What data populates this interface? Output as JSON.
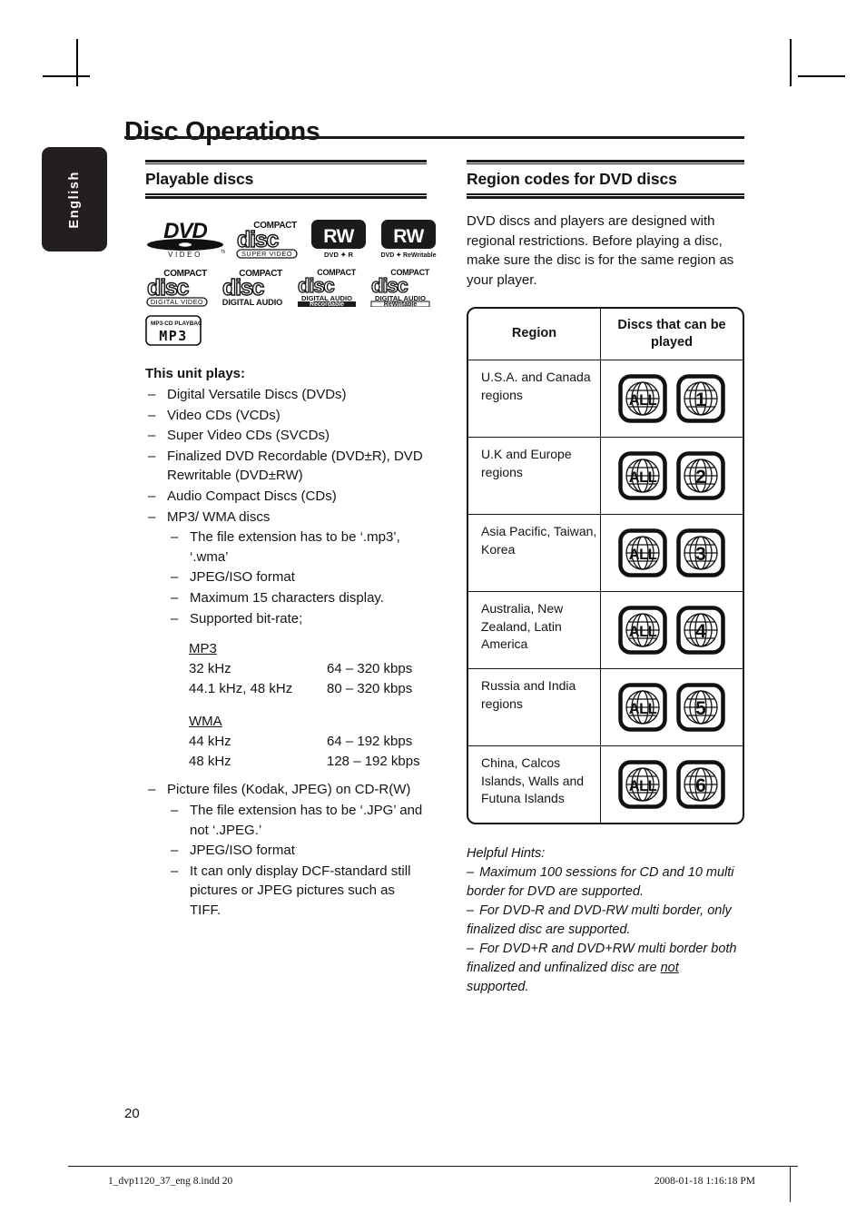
{
  "document": {
    "title": "Disc Operations",
    "language_tab": "English",
    "page_number": "20"
  },
  "footer": {
    "file": "1_dvp1120_37_eng 8.indd   20",
    "timestamp": "2008-01-18   1:16:18 PM"
  },
  "left_column": {
    "heading": "Playable discs",
    "logos": [
      {
        "name": "dvd-video-logo",
        "top": "DVD",
        "bottom": "V I D E O ™"
      },
      {
        "name": "compact-disc-super-video-logo",
        "top": "COMPACT",
        "mid": "disc",
        "bottom": "SUPER  VIDEO"
      },
      {
        "name": "dvd-plus-r-logo",
        "mark": "RW",
        "caption": "DVD ✦ R"
      },
      {
        "name": "dvd-plus-rewritable-logo",
        "mark": "RW",
        "caption": "DVD ✦ ReWritable"
      },
      {
        "name": "compact-disc-digital-video-logo",
        "top": "COMPACT",
        "mid": "disc",
        "bottom": "DIGITAL VIDEO"
      },
      {
        "name": "compact-disc-digital-audio-logo",
        "top": "COMPACT",
        "mid": "disc",
        "bottom": "DIGITAL AUDIO"
      },
      {
        "name": "compact-disc-recordable-logo",
        "top": "COMPACT",
        "mid": "disc",
        "bottom": "DIGITAL AUDIO",
        "bottom2": "Recordable"
      },
      {
        "name": "compact-disc-rewritable-logo",
        "top": "COMPACT",
        "mid": "disc",
        "bottom": "DIGITAL AUDIO",
        "bottom2": "ReWritable"
      },
      {
        "name": "mp3-cd-playback-logo",
        "top": "MP3-CD PLAYBACK",
        "mid": "MP3"
      }
    ],
    "plays_title": "This unit plays:",
    "plays_items": [
      "Digital Versatile Discs (DVDs)",
      "Video CDs (VCDs)",
      "Super Video CDs (SVCDs)",
      "Finalized DVD Recordable (DVD±R), DVD Rewritable (DVD±RW)",
      "Audio Compact Discs (CDs)",
      "MP3/ WMA discs"
    ],
    "mp3_sub_items": [
      "The file extension has to be ‘.mp3’, ‘.wma’",
      "JPEG/ISO format",
      "Maximum 15 characters display.",
      "Supported bit-rate;"
    ],
    "bitrate": {
      "mp3_label": "MP3",
      "mp3_rows": [
        {
          "freq": "32 kHz",
          "rate": "64 – 320 kbps"
        },
        {
          "freq": "44.1 kHz, 48 kHz",
          "rate": "80 – 320 kbps"
        }
      ],
      "wma_label": "WMA",
      "wma_rows": [
        {
          "freq": "44 kHz",
          "rate": "64 – 192 kbps"
        },
        {
          "freq": "48 kHz",
          "rate": "128 – 192 kbps"
        }
      ]
    },
    "picture_item": "Picture files (Kodak, JPEG) on CD-R(W)",
    "picture_sub_items": [
      "The file extension has to be ‘.JPG’ and not ‘.JPEG.’",
      "JPEG/ISO format",
      "It can only display DCF-standard still pictures or JPEG pictures such as TIFF."
    ]
  },
  "right_column": {
    "heading": "Region codes for DVD discs",
    "intro": "DVD discs and players are designed with regional restrictions. Before playing a disc, make sure the disc is for the same region as your player.",
    "table": {
      "headers": [
        "Region",
        "Discs that can be played"
      ],
      "rows": [
        {
          "region": "U.S.A. and Canada regions",
          "codes": [
            "ALL",
            "1"
          ]
        },
        {
          "region": "U.K and Europe regions",
          "codes": [
            "ALL",
            "2"
          ]
        },
        {
          "region": "Asia Pacific, Taiwan, Korea",
          "codes": [
            "ALL",
            "3"
          ]
        },
        {
          "region": "Australia, New Zealand, Latin America",
          "codes": [
            "ALL",
            "4"
          ]
        },
        {
          "region": "Russia and India regions",
          "codes": [
            "ALL",
            "5"
          ]
        },
        {
          "region": "China, Calcos Islands, Walls and Futuna Islands",
          "codes": [
            "ALL",
            "6"
          ]
        }
      ]
    },
    "hints_title": "Helpful Hints:",
    "hints": [
      "Maximum 100 sessions for CD and 10 multi border for DVD are supported.",
      "For DVD-R and DVD-RW multi border, only finalized disc are supported.",
      "For DVD+R and DVD+RW multi border both finalized and unfinalized disc are not supported."
    ]
  }
}
